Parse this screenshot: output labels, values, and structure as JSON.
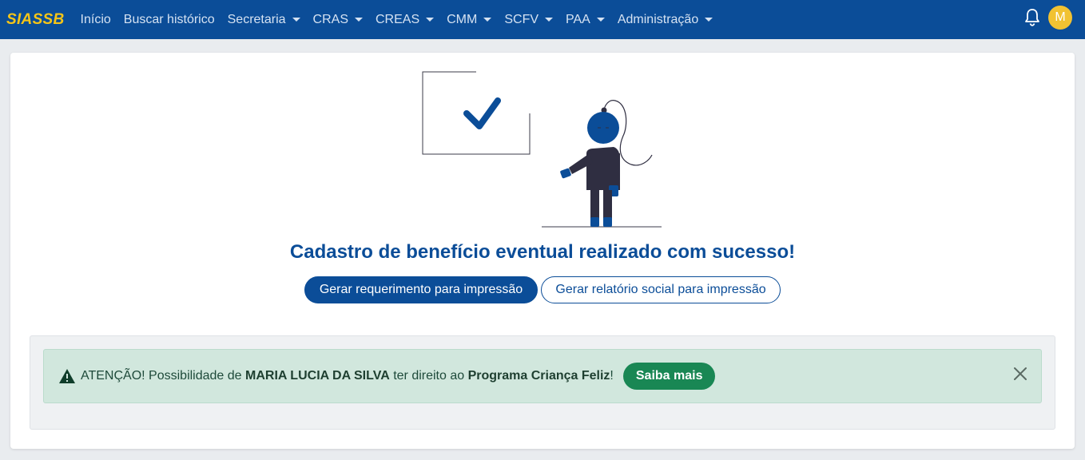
{
  "navbar": {
    "brand": "SIASSB",
    "items": [
      {
        "label": "Início",
        "dropdown": false
      },
      {
        "label": "Buscar histórico",
        "dropdown": false
      },
      {
        "label": "Secretaria",
        "dropdown": true
      },
      {
        "label": "CRAS",
        "dropdown": true
      },
      {
        "label": "CREAS",
        "dropdown": true
      },
      {
        "label": "CMM",
        "dropdown": true
      },
      {
        "label": "SCFV",
        "dropdown": true
      },
      {
        "label": "PAA",
        "dropdown": true
      },
      {
        "label": "Administração",
        "dropdown": true
      }
    ],
    "notification_icon": "bell-icon",
    "avatar_initial": "M"
  },
  "main": {
    "success_message": "Cadastro de benefício eventual realizado com sucesso!",
    "print_request_button": "Gerar requerimento para impressão",
    "print_report_button": "Gerar relatório social para impressão"
  },
  "alert": {
    "icon": "warning-triangle-icon",
    "prefix": "ATENÇÃO! Possibilidade de ",
    "person_name": "MARIA LUCIA DA SILVA",
    "middle": " ter direito ao ",
    "program": "Programa Criança Feliz",
    "suffix": "!",
    "more_button": "Saiba mais"
  },
  "colors": {
    "primary": "#0b4d98",
    "brand": "#f5c518",
    "success": "#198754",
    "alert_bg": "#d1e7dd"
  }
}
